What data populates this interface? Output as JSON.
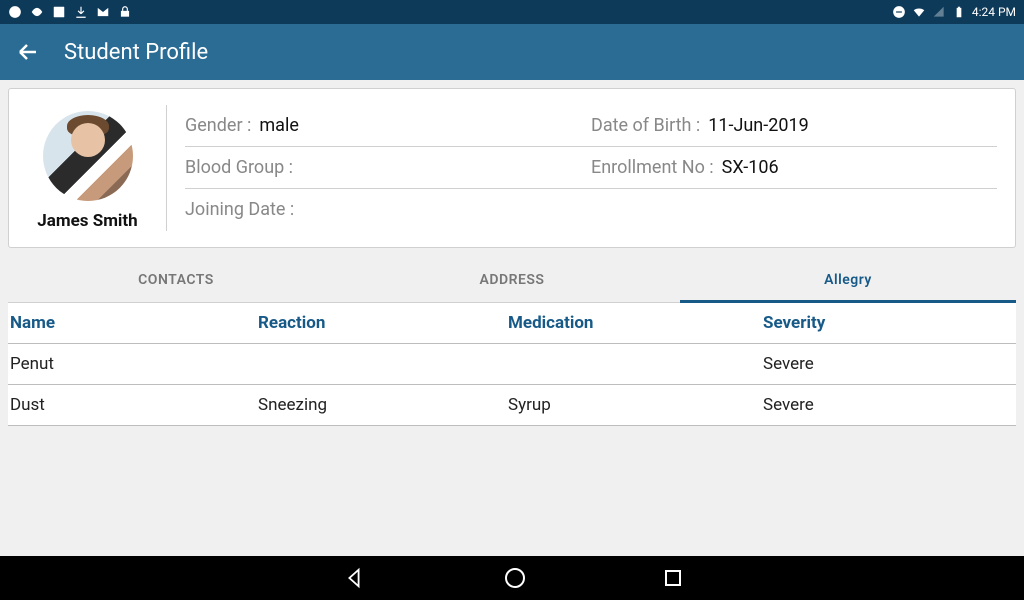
{
  "status": {
    "time": "4:24 PM"
  },
  "app_bar": {
    "title": "Student Profile"
  },
  "profile": {
    "student_name": "James Smith",
    "labels": {
      "gender": "Gender :",
      "dob": "Date of Birth :",
      "blood_group": "Blood Group :",
      "enrollment_no": "Enrollment No :",
      "joining_date": "Joining Date :"
    },
    "values": {
      "gender": "male",
      "dob": "11-Jun-2019",
      "blood_group": "",
      "enrollment_no": "SX-106",
      "joining_date": ""
    }
  },
  "tabs": {
    "contacts": "CONTACTS",
    "address": "ADDRESS",
    "allergy": "Allegry"
  },
  "table": {
    "headers": {
      "name": "Name",
      "reaction": "Reaction",
      "medication": "Medication",
      "severity": "Severity"
    },
    "rows": [
      {
        "name": "Penut",
        "reaction": "",
        "medication": "",
        "severity": "Severe"
      },
      {
        "name": "Dust",
        "reaction": "Sneezing",
        "medication": "Syrup",
        "severity": "Severe"
      }
    ]
  }
}
